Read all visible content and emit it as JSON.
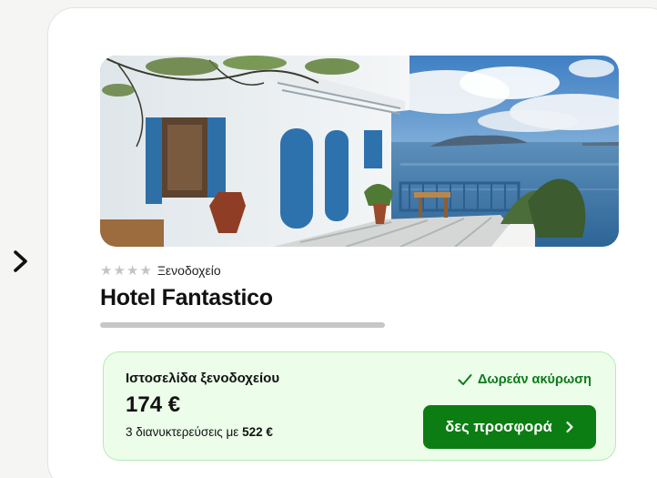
{
  "hotel": {
    "stars": 4,
    "star_glyph": "★",
    "category": "Ξενοδοχείο",
    "name": "Hotel Fantastico",
    "image_icon": "hotel-photo"
  },
  "offer": {
    "provider": "Ιστοσελίδα ξενοδοχείου",
    "price": "174 €",
    "nights_prefix": "3 διανυκτερεύσεις με",
    "nights_total": "522 €",
    "free_cancellation": "Δωρεάν ακύρωση",
    "deal_button": "δες προσφορά",
    "accent_color": "#0c7d12",
    "background_color": "#ecfdea"
  },
  "navigation": {
    "prev_icon": "chevron-right-icon"
  }
}
